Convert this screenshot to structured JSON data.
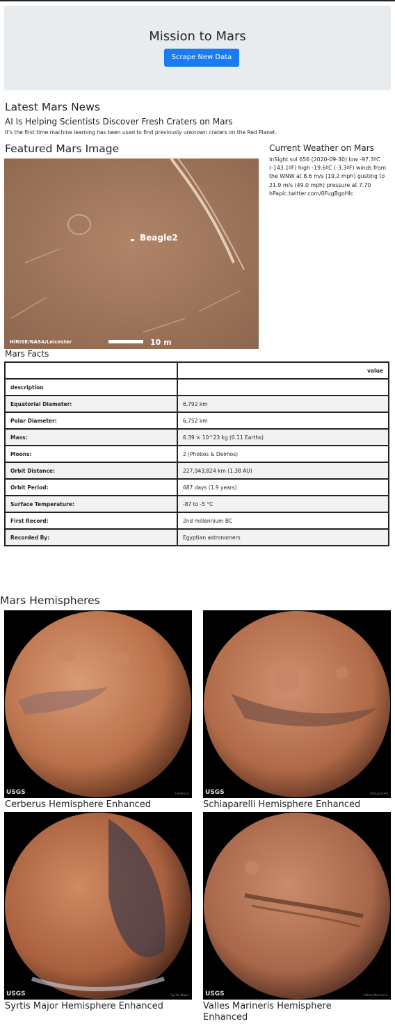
{
  "header": {
    "title": "Mission to Mars",
    "scrape_button": "Scrape New Data"
  },
  "news": {
    "section_title": "Latest Mars News",
    "headline": "AI Is Helping Scientists Discover Fresh Craters on Mars",
    "teaser": "It's the first time machine learning has been used to find previously unknown craters on the Red Planet."
  },
  "featured": {
    "section_title": "Featured Mars Image",
    "image_label": "Beagle2",
    "credit": "HiRISE/NASA/Leicester",
    "scale_label": "10 m"
  },
  "weather": {
    "section_title": "Current Weather on Mars",
    "text": "InSight sol 656 (2020-09-30) low -97.3ºC (-143.1ºF) high -19.6ºC (-3.3ºF) winds from the WNW at 8.6 m/s (19.2 mph) gusting to 21.9 m/s (49.0 mph) pressure at 7.70 hPapic.twitter.com/0FugBgoHIc"
  },
  "facts": {
    "section_title": "Mars Facts",
    "column_header": "value",
    "index_label": "description",
    "rows": [
      {
        "label": "Equatorial Diameter:",
        "value": "6,792 km"
      },
      {
        "label": "Polar Diameter:",
        "value": "6,752 km"
      },
      {
        "label": "Mass:",
        "value": "6.39 × 10^23 kg (0.11 Earths)"
      },
      {
        "label": "Moons:",
        "value": "2 (Phobos & Deimos)"
      },
      {
        "label": "Orbit Distance:",
        "value": "227,943,824 km (1.38 AU)"
      },
      {
        "label": "Orbit Period:",
        "value": "687 days (1.9 years)"
      },
      {
        "label": "Surface Temperature:",
        "value": "-87 to -5 °C"
      },
      {
        "label": "First Record:",
        "value": "2nd millennium BC"
      },
      {
        "label": "Recorded By:",
        "value": "Egyptian astronomers"
      }
    ]
  },
  "hemispheres": {
    "section_title": "Mars Hemispheres",
    "items": [
      {
        "title": "Cerberus Hemisphere Enhanced",
        "badge": "USGS",
        "caption": "Cerberus"
      },
      {
        "title": "Schiaparelli Hemisphere Enhanced",
        "badge": "USGS",
        "caption": "Schiaparelli"
      },
      {
        "title": "Syrtis Major Hemisphere Enhanced",
        "badge": "USGS",
        "caption": "Syrtis Major"
      },
      {
        "title": "Valles Marineris Hemisphere Enhanced",
        "badge": "USGS",
        "caption": "Valles Marineris"
      }
    ]
  },
  "colors": {
    "button": "#1a7cf5",
    "jumbotron": "#e9ecef",
    "mars_surface": "#a0765a"
  }
}
